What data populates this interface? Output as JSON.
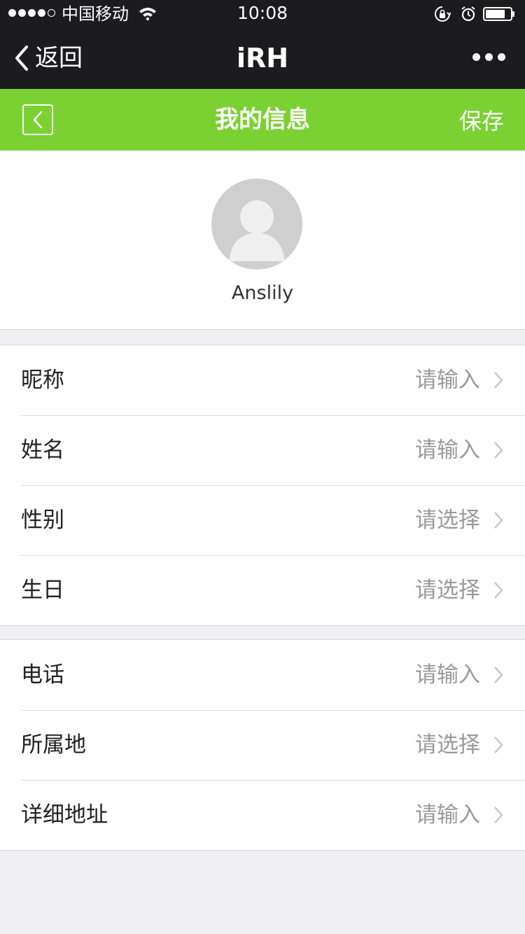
{
  "status_bar": {
    "carrier": "中国移动",
    "time": "10:08",
    "signal_bars_filled": 4,
    "signal_bars_total": 5,
    "battery_level": 0.8,
    "icons": [
      "wifi-icon",
      "rotation-lock-icon",
      "alarm-icon",
      "battery-icon"
    ]
  },
  "wechat_nav": {
    "back_label": "返回",
    "title": "iRH",
    "more_icon": "ellipsis-icon"
  },
  "header": {
    "title": "我的信息",
    "save_label": "保存",
    "background_color": "#7bd132"
  },
  "profile": {
    "avatar_icon": "default-user-avatar",
    "username": "Anslily"
  },
  "groups": [
    {
      "rows": [
        {
          "label": "昵称",
          "value": "请输入"
        },
        {
          "label": "姓名",
          "value": "请输入"
        },
        {
          "label": "性别",
          "value": "请选择"
        },
        {
          "label": "生日",
          "value": "请选择"
        }
      ]
    },
    {
      "rows": [
        {
          "label": "电话",
          "value": "请输入"
        },
        {
          "label": "所属地",
          "value": "请选择"
        },
        {
          "label": "详细地址",
          "value": "请输入"
        }
      ]
    }
  ]
}
